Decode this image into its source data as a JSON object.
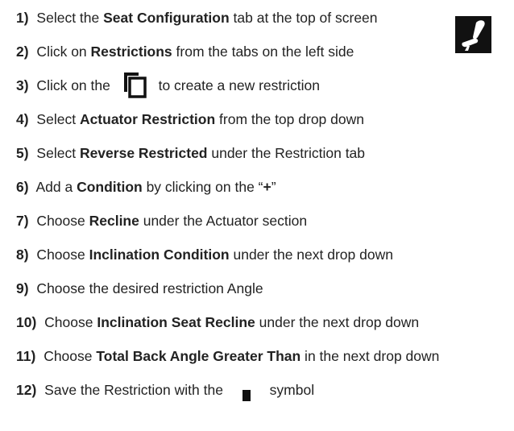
{
  "steps": [
    {
      "num": "1)",
      "parts": [
        {
          "t": " Select the "
        },
        {
          "b": "Seat Configuration"
        },
        {
          "t": " tab at the top of screen"
        }
      ]
    },
    {
      "num": "2)",
      "parts": [
        {
          "t": " Click on "
        },
        {
          "b": "Restrictions"
        },
        {
          "t": " from the tabs on the left side"
        }
      ]
    },
    {
      "num": "3)",
      "parts": [
        {
          "t": " Click on the "
        },
        {
          "icon": "copy-icon"
        },
        {
          "t": " to create a new restriction"
        }
      ]
    },
    {
      "num": "4)",
      "parts": [
        {
          "t": " Select "
        },
        {
          "b": "Actuator Restriction"
        },
        {
          "t": " from the top drop down"
        }
      ]
    },
    {
      "num": "5)",
      "parts": [
        {
          "t": " Select "
        },
        {
          "b": "Reverse Restricted"
        },
        {
          "t": " under the Restriction tab"
        }
      ]
    },
    {
      "num": "6)",
      "parts": [
        {
          "t": " Add a "
        },
        {
          "b": "Condition"
        },
        {
          "t": " by clicking on the “"
        },
        {
          "b": "+"
        },
        {
          "t": "”"
        }
      ]
    },
    {
      "num": "7)",
      "parts": [
        {
          "t": " Choose "
        },
        {
          "b": "Recline"
        },
        {
          "t": " under the Actuator section"
        }
      ]
    },
    {
      "num": "8)",
      "parts": [
        {
          "t": " Choose "
        },
        {
          "b": "Inclination Condition"
        },
        {
          "t": " under the next drop down"
        }
      ]
    },
    {
      "num": "9)",
      "parts": [
        {
          "t": " Choose the desired restriction Angle"
        }
      ]
    },
    {
      "num": "10)",
      "parts": [
        {
          "t": " Choose "
        },
        {
          "b": "Inclination Seat Recline"
        },
        {
          "t": " under the next drop down"
        }
      ]
    },
    {
      "num": "11)",
      "parts": [
        {
          "t": " Choose "
        },
        {
          "b": "Total Back Angle Greater Than"
        },
        {
          "t": " in the next drop down"
        }
      ]
    },
    {
      "num": "12)",
      "parts": [
        {
          "t": " Save the Restriction with the "
        },
        {
          "icon": "save-icon"
        },
        {
          "t": " symbol"
        }
      ]
    }
  ],
  "logo": {
    "icon": "seat-recline-logo-icon",
    "bg": "#111111",
    "fg": "#ffffff"
  }
}
